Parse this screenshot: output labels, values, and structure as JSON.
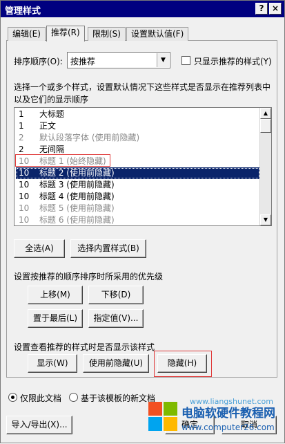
{
  "window": {
    "title": "管理样式",
    "help_glyph": "?",
    "close_glyph": "×"
  },
  "tabs": [
    {
      "label": "编辑(E)",
      "active": false
    },
    {
      "label": "推荐(R)",
      "active": true
    },
    {
      "label": "限制(S)",
      "active": false
    },
    {
      "label": "设置默认值(F)",
      "active": false
    }
  ],
  "sort": {
    "label": "排序顺序(O):",
    "value": "按推荐",
    "arrow": "▼"
  },
  "only_recommended": {
    "label": "只显示推荐的样式(Y)",
    "checked": false
  },
  "instruction": {
    "line1": "选择一个或多个样式，设置默认情况下这些样式是否显示在推荐列表中",
    "line2": "以及它们的显示顺序"
  },
  "styles": [
    {
      "num": "1",
      "name": "大标题",
      "dim": false,
      "selected": false
    },
    {
      "num": "1",
      "name": "正文",
      "dim": false,
      "selected": false
    },
    {
      "num": "2",
      "name": "默认段落字体  (使用前隐藏)",
      "dim": true,
      "selected": false
    },
    {
      "num": "2",
      "name": "无间隔",
      "dim": false,
      "selected": false
    },
    {
      "num": "10",
      "name": "标题 1  (始终隐藏)",
      "dim": true,
      "selected": false
    },
    {
      "num": "10",
      "name": "标题 2  (使用前隐藏)",
      "dim": false,
      "selected": true
    },
    {
      "num": "10",
      "name": "标题 3  (使用前隐藏)",
      "dim": false,
      "selected": false
    },
    {
      "num": "10",
      "name": "标题 4  (使用前隐藏)",
      "dim": false,
      "selected": false
    },
    {
      "num": "10",
      "name": "标题 5  (使用前隐藏)",
      "dim": true,
      "selected": false
    },
    {
      "num": "10",
      "name": "标题 6  (使用前隐藏)",
      "dim": true,
      "selected": false
    }
  ],
  "scroll": {
    "up": "▲",
    "down": "▼"
  },
  "select_buttons": {
    "select_all": "全选(A)",
    "select_builtin": "选择内置样式(B)"
  },
  "priority": {
    "label": "设置按推荐的顺序排序时所采用的优先级",
    "move_up": "上移(M)",
    "move_down": "下移(D)",
    "move_last": "置于最后(L)",
    "assign_value": "指定值(V)..."
  },
  "visibility": {
    "label": "设置查看推荐的样式时是否显示该样式",
    "show": "显示(W)",
    "hide_until_used": "使用前隐藏(U)",
    "hide": "隐藏(H)"
  },
  "scope": {
    "this_document": "仅限此文档",
    "new_documents": "基于该模板的新文档",
    "selected": "this_document"
  },
  "footer": {
    "import_export": "导入/导出(X)...",
    "ok": "确定",
    "cancel": "取消"
  },
  "watermark": {
    "title": "电脑软硬件教程网",
    "url": "www.computer26.com",
    "url2": "www.liangshunet.com"
  },
  "colors": {
    "titlebar": "#000080",
    "selection": "#0a246a",
    "highlight": "#e03a3a",
    "watermark": "#1a5fb0"
  }
}
